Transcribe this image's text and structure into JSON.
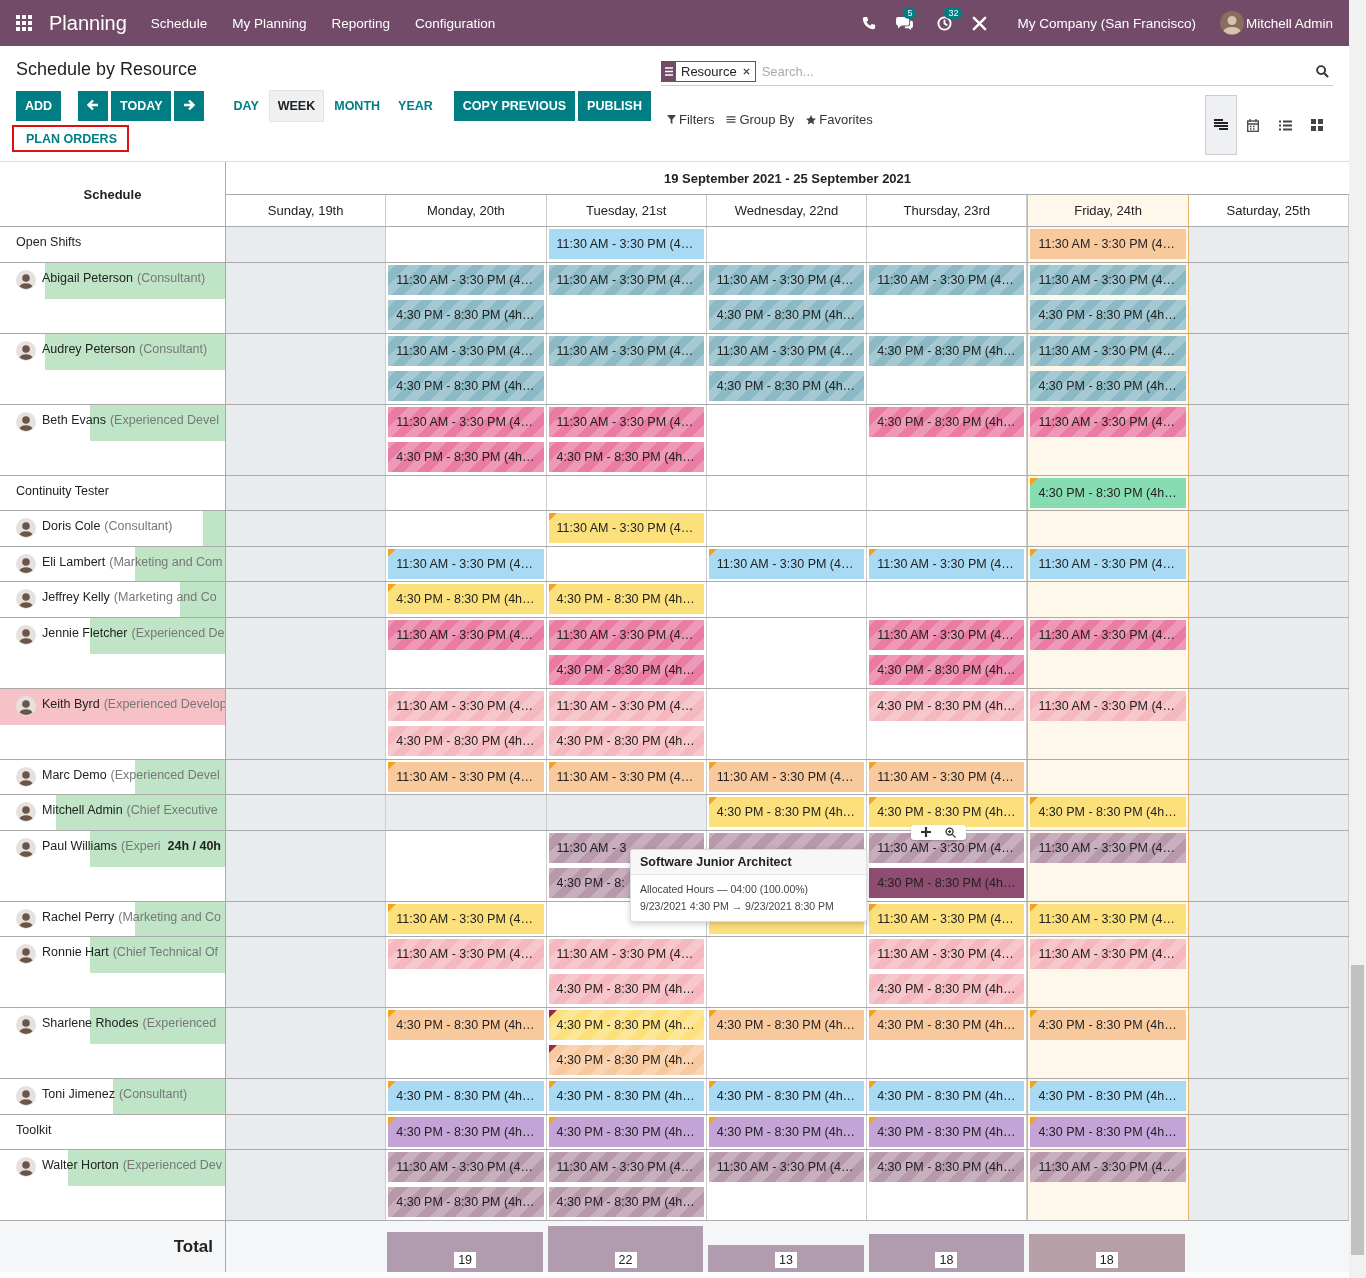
{
  "navbar": {
    "app": "Planning",
    "menu": [
      "Schedule",
      "My Planning",
      "Reporting",
      "Configuration"
    ],
    "messages_badge": "5",
    "activities_badge": "32",
    "company": "My Company (San Francisco)",
    "user": "Mitchell Admin"
  },
  "control_panel": {
    "title": "Schedule by Resource",
    "add": "ADD",
    "today": "TODAY",
    "scales": [
      {
        "label": "DAY",
        "selected": false
      },
      {
        "label": "WEEK",
        "selected": true
      },
      {
        "label": "MONTH",
        "selected": false
      },
      {
        "label": "YEAR",
        "selected": false
      }
    ],
    "actions": [
      "COPY PREVIOUS",
      "PUBLISH"
    ],
    "plan_orders": "PLAN ORDERS",
    "search": {
      "facet": "Resource",
      "placeholder": "Search..."
    },
    "filters": [
      "Filters",
      "Group By",
      "Favorites"
    ],
    "view_modes": [
      {
        "kind": "gantt",
        "selected": true
      },
      {
        "kind": "calendar",
        "selected": false
      },
      {
        "kind": "list",
        "selected": false
      },
      {
        "kind": "kanban",
        "selected": false
      }
    ]
  },
  "gantt": {
    "corner": "Schedule",
    "range": "19 September 2021 - 25 September 2021",
    "days": [
      {
        "label": "Sunday, 19th",
        "weekend": true,
        "today": false
      },
      {
        "label": "Monday, 20th",
        "weekend": false,
        "today": false
      },
      {
        "label": "Tuesday, 21st",
        "weekend": false,
        "today": false
      },
      {
        "label": "Wednesday, 22nd",
        "weekend": false,
        "today": false
      },
      {
        "label": "Thursday, 23rd",
        "weekend": false,
        "today": false
      },
      {
        "label": "Friday, 24th",
        "weekend": false,
        "today": true
      },
      {
        "label": "Saturday, 25th",
        "weekend": true,
        "today": false
      }
    ],
    "rows": [
      {
        "name": "Open Shifts",
        "kind": "group",
        "cells": [
          {},
          {},
          {
            "pills": [
              {
                "text": "11:30 AM - 3:30 PM (4…",
                "color": "#a8daf4",
                "striped": false
              }
            ]
          },
          {},
          {},
          {
            "pills": [
              {
                "text": "11:30 AM - 3:30 PM (4…",
                "color": "#f9c99e",
                "striped": false
              }
            ]
          },
          {}
        ]
      },
      {
        "name": "Abigail Peterson",
        "role": "(Consultant)",
        "kind": "person",
        "level": 0.8,
        "overloaded": false,
        "cells": [
          {},
          {
            "pills": [
              {
                "text": "11:30 AM - 3:30 PM (4…",
                "color": "#8bbac6",
                "striped": true
              },
              {
                "text": "4:30 PM - 8:30 PM (4h…",
                "color": "#8bbac6",
                "striped": true
              }
            ]
          },
          {
            "pills": [
              {
                "text": "11:30 AM - 3:30 PM (4…",
                "color": "#8bbac6",
                "striped": true
              }
            ]
          },
          {
            "pills": [
              {
                "text": "11:30 AM - 3:30 PM (4…",
                "color": "#8bbac6",
                "striped": true
              },
              {
                "text": "4:30 PM - 8:30 PM (4h…",
                "color": "#8bbac6",
                "striped": true
              }
            ]
          },
          {
            "pills": [
              {
                "text": "11:30 AM - 3:30 PM (4…",
                "color": "#8bbac6",
                "striped": true
              }
            ]
          },
          {
            "pills": [
              {
                "text": "11:30 AM - 3:30 PM (4…",
                "color": "#8bbac6",
                "striped": true
              },
              {
                "text": "4:30 PM - 8:30 PM (4h…",
                "color": "#8bbac6",
                "striped": true
              }
            ]
          },
          {}
        ]
      },
      {
        "name": "Audrey Peterson",
        "role": "(Consultant)",
        "kind": "person",
        "level": 0.8,
        "overloaded": false,
        "cells": [
          {},
          {
            "pills": [
              {
                "text": "11:30 AM - 3:30 PM (4…",
                "color": "#8bbac6",
                "striped": true
              },
              {
                "text": "4:30 PM - 8:30 PM (4h…",
                "color": "#8bbac6",
                "striped": true
              }
            ]
          },
          {
            "pills": [
              {
                "text": "11:30 AM - 3:30 PM (4…",
                "color": "#8bbac6",
                "striped": true
              }
            ]
          },
          {
            "pills": [
              {
                "text": "11:30 AM - 3:30 PM (4…",
                "color": "#8bbac6",
                "striped": true
              },
              {
                "text": "4:30 PM - 8:30 PM (4h…",
                "color": "#8bbac6",
                "striped": true
              }
            ]
          },
          {
            "pills": [
              {
                "text": "4:30 PM - 8:30 PM (4h…",
                "color": "#8bbac6",
                "striped": true
              }
            ]
          },
          {
            "pills": [
              {
                "text": "11:30 AM - 3:30 PM (4…",
                "color": "#8bbac6",
                "striped": true
              },
              {
                "text": "4:30 PM - 8:30 PM (4h…",
                "color": "#8bbac6",
                "striped": true
              }
            ]
          },
          {}
        ]
      },
      {
        "name": "Beth Evans",
        "role": "(Experienced Devel",
        "kind": "person",
        "level": 0.6,
        "overloaded": false,
        "cells": [
          {},
          {
            "pills": [
              {
                "text": "11:30 AM - 3:30 PM (4…",
                "color": "#ea7ba3",
                "striped": true
              },
              {
                "text": "4:30 PM - 8:30 PM (4h…",
                "color": "#ea7ba3",
                "striped": true
              }
            ]
          },
          {
            "pills": [
              {
                "text": "11:30 AM - 3:30 PM (4…",
                "color": "#ea7ba3",
                "striped": true
              },
              {
                "text": "4:30 PM - 8:30 PM (4h…",
                "color": "#ea7ba3",
                "striped": true
              }
            ]
          },
          {},
          {
            "pills": [
              {
                "text": "4:30 PM - 8:30 PM (4h…",
                "color": "#ea7ba3",
                "striped": true
              }
            ]
          },
          {
            "pills": [
              {
                "text": "11:30 AM - 3:30 PM (4…",
                "color": "#ea7ba3",
                "striped": true
              }
            ]
          },
          {}
        ]
      },
      {
        "name": "Continuity Tester",
        "kind": "group",
        "cells": [
          {},
          {},
          {},
          {},
          {},
          {
            "pills": [
              {
                "text": "4:30 PM - 8:30 PM (4h…",
                "color": "#86ddb1",
                "striped": false,
                "corner": {
                  "color": "#f5a11c"
                }
              }
            ]
          },
          {}
        ]
      },
      {
        "name": "Doris Cole",
        "role": "(Consultant)",
        "kind": "person",
        "level": 0.1,
        "overloaded": false,
        "cells": [
          {},
          {},
          {
            "pills": [
              {
                "text": "11:30 AM - 3:30 PM (4…",
                "color": "#fbe07c",
                "striped": false,
                "corner": {
                  "color": "#f5a11c"
                }
              }
            ]
          },
          {},
          {},
          {},
          {}
        ]
      },
      {
        "name": "Eli Lambert",
        "role": "(Marketing and Com",
        "kind": "person",
        "level": 0.4,
        "overloaded": false,
        "cells": [
          {},
          {
            "pills": [
              {
                "text": "11:30 AM - 3:30 PM (4…",
                "color": "#a8daf4",
                "striped": false,
                "corner": {
                  "color": "#f5a11c"
                }
              }
            ]
          },
          {},
          {
            "pills": [
              {
                "text": "11:30 AM - 3:30 PM (4…",
                "color": "#a8daf4",
                "striped": false,
                "corner": {
                  "color": "#f5a11c"
                }
              }
            ]
          },
          {
            "pills": [
              {
                "text": "11:30 AM - 3:30 PM (4…",
                "color": "#a8daf4",
                "striped": false,
                "corner": {
                  "color": "#f5a11c"
                }
              }
            ]
          },
          {
            "pills": [
              {
                "text": "11:30 AM - 3:30 PM (4…",
                "color": "#a8daf4",
                "striped": false,
                "corner": {
                  "color": "#f5a11c"
                }
              }
            ]
          },
          {}
        ]
      },
      {
        "name": "Jeffrey Kelly",
        "role": "(Marketing and Co",
        "kind": "person",
        "level": 0.2,
        "overloaded": false,
        "cells": [
          {},
          {
            "pills": [
              {
                "text": "4:30 PM - 8:30 PM (4h…",
                "color": "#fbe07c",
                "striped": false,
                "corner": {
                  "color": "#f5a11c"
                }
              }
            ]
          },
          {
            "pills": [
              {
                "text": "4:30 PM - 8:30 PM (4h…",
                "color": "#fbe07c",
                "striped": false,
                "corner": {
                  "color": "#f5a11c"
                }
              }
            ]
          },
          {},
          {},
          {},
          {}
        ]
      },
      {
        "name": "Jennie Fletcher",
        "role": "(Experienced De",
        "kind": "person",
        "level": 0.6,
        "overloaded": false,
        "cells": [
          {},
          {
            "pills": [
              {
                "text": "11:30 AM - 3:30 PM (4…",
                "color": "#ea7ba3",
                "striped": true
              }
            ]
          },
          {
            "pills": [
              {
                "text": "11:30 AM - 3:30 PM (4…",
                "color": "#ea7ba3",
                "striped": true
              },
              {
                "text": "4:30 PM - 8:30 PM (4h…",
                "color": "#ea7ba3",
                "striped": true
              }
            ]
          },
          {},
          {
            "pills": [
              {
                "text": "11:30 AM - 3:30 PM (4…",
                "color": "#ea7ba3",
                "striped": true
              },
              {
                "text": "4:30 PM - 8:30 PM (4h…",
                "color": "#ea7ba3",
                "striped": true
              }
            ]
          },
          {
            "pills": [
              {
                "text": "11:30 AM - 3:30 PM (4…",
                "color": "#ea7ba3",
                "striped": true
              }
            ]
          },
          {}
        ]
      },
      {
        "name": "Keith Byrd",
        "role": "(Experienced Develop",
        "kind": "person",
        "level": 1,
        "overloaded": true,
        "cells": [
          {},
          {
            "pills": [
              {
                "text": "11:30 AM - 3:30 PM (4…",
                "color": "#f4b8be",
                "striped": true
              },
              {
                "text": "4:30 PM - 8:30 PM (4h…",
                "color": "#f4b8be",
                "striped": true
              }
            ]
          },
          {
            "pills": [
              {
                "text": "11:30 AM - 3:30 PM (4…",
                "color": "#f4b8be",
                "striped": true
              },
              {
                "text": "4:30 PM - 8:30 PM (4h…",
                "color": "#f4b8be",
                "striped": true
              }
            ]
          },
          {},
          {
            "pills": [
              {
                "text": "4:30 PM - 8:30 PM (4h…",
                "color": "#f4b8be",
                "striped": true
              }
            ]
          },
          {
            "pills": [
              {
                "text": "11:30 AM - 3:30 PM (4…",
                "color": "#f4b8be",
                "striped": true
              }
            ]
          },
          {}
        ]
      },
      {
        "name": "Marc Demo",
        "role": "(Experienced Devel",
        "kind": "person",
        "level": 0.4,
        "overloaded": false,
        "cells": [
          {},
          {
            "pills": [
              {
                "text": "11:30 AM - 3:30 PM (4…",
                "color": "#f9c99e",
                "striped": false,
                "corner": {
                  "color": "#f5a11c"
                }
              }
            ]
          },
          {
            "pills": [
              {
                "text": "11:30 AM - 3:30 PM (4…",
                "color": "#f9c99e",
                "striped": false,
                "corner": {
                  "color": "#f5a11c"
                }
              }
            ]
          },
          {
            "pills": [
              {
                "text": "11:30 AM - 3:30 PM (4…",
                "color": "#f9c99e",
                "striped": false,
                "corner": {
                  "color": "#f5a11c"
                }
              }
            ]
          },
          {
            "pills": [
              {
                "text": "11:30 AM - 3:30 PM (4…",
                "color": "#f9c99e",
                "striped": false,
                "corner": {
                  "color": "#f5a11c"
                }
              }
            ]
          },
          {},
          {}
        ]
      },
      {
        "name": "Mitchell Admin",
        "role": "(Chief Executive",
        "kind": "person",
        "level": 0.75,
        "overloaded": false,
        "cells": [
          {},
          {
            "unavailable": true
          },
          {
            "unavailable": true
          },
          {
            "pills": [
              {
                "text": "4:30 PM - 8:30 PM (4h…",
                "color": "#fbe07c",
                "striped": false,
                "corner": {
                  "color": "#f5a11c"
                }
              }
            ]
          },
          {
            "pills": [
              {
                "text": "4:30 PM - 8:30 PM (4h…",
                "color": "#fbe07c",
                "striped": false,
                "corner": {
                  "color": "#f5a11c"
                }
              }
            ]
          },
          {
            "pills": [
              {
                "text": "4:30 PM - 8:30 PM (4h…",
                "color": "#fbe07c",
                "striped": false,
                "corner": {
                  "color": "#f5a11c"
                }
              }
            ]
          },
          {}
        ]
      },
      {
        "name": "Paul Williams",
        "role": "(Experi",
        "hours": "24h / 40h",
        "kind": "person",
        "level": 0.6,
        "overloaded": false,
        "cells": [
          {},
          {},
          {
            "pills": [
              {
                "text": "11:30 AM - 3",
                "color": "#b899ab",
                "striped": true
              },
              {
                "text": "4:30 PM - 8:",
                "color": "#b899ab",
                "striped": true
              }
            ]
          },
          {
            "pills": [
              {
                "color": "#b899ab",
                "striped": true
              }
            ]
          },
          {
            "pills": [
              {
                "text": "11:30 AM - 3:30 PM (4…",
                "color": "#b899ab",
                "striped": true,
                "hovered": true
              },
              {
                "text": "4:30 PM - 8:30 PM (4h…",
                "color": "#8f4d72",
                "striped": false
              }
            ]
          },
          {
            "pills": [
              {
                "text": "11:30 AM - 3:30 PM (4…",
                "color": "#b899ab",
                "striped": true
              }
            ]
          },
          {}
        ]
      },
      {
        "name": "Rachel Perry",
        "role": "(Marketing and Co",
        "kind": "person",
        "level": 0.4,
        "overloaded": false,
        "cells": [
          {},
          {
            "pills": [
              {
                "text": "11:30 AM - 3:30 PM (4…",
                "color": "#fbe07c",
                "striped": false,
                "corner": {
                  "color": "#f5a11c"
                }
              }
            ]
          },
          {},
          {
            "pills": [
              {
                "color": "#fbe07c",
                "striped": false
              }
            ]
          },
          {
            "pills": [
              {
                "text": "11:30 AM - 3:30 PM (4…",
                "color": "#fbe07c",
                "striped": false,
                "corner": {
                  "color": "#f5a11c"
                }
              }
            ]
          },
          {
            "pills": [
              {
                "text": "11:30 AM - 3:30 PM (4…",
                "color": "#fbe07c",
                "striped": false,
                "corner": {
                  "color": "#f5a11c"
                }
              }
            ]
          },
          {}
        ]
      },
      {
        "name": "Ronnie Hart",
        "role": "(Chief Technical Of",
        "kind": "person",
        "level": 0.6,
        "overloaded": false,
        "cells": [
          {},
          {
            "pills": [
              {
                "text": "11:30 AM - 3:30 PM (4…",
                "color": "#f4b8be",
                "striped": true
              }
            ]
          },
          {
            "pills": [
              {
                "text": "11:30 AM - 3:30 PM (4…",
                "color": "#f4b8be",
                "striped": true
              },
              {
                "text": "4:30 PM - 8:30 PM (4h…",
                "color": "#f4b8be",
                "striped": true
              }
            ]
          },
          {},
          {
            "pills": [
              {
                "text": "11:30 AM - 3:30 PM (4…",
                "color": "#f4b8be",
                "striped": true
              },
              {
                "text": "4:30 PM - 8:30 PM (4h…",
                "color": "#f4b8be",
                "striped": true
              }
            ]
          },
          {
            "pills": [
              {
                "text": "11:30 AM - 3:30 PM (4…",
                "color": "#f4b8be",
                "striped": true
              }
            ]
          },
          {}
        ]
      },
      {
        "name": "Sharlene Rhodes",
        "role": "(Experienced",
        "kind": "person",
        "level": 0.6,
        "overloaded": false,
        "cells": [
          {},
          {
            "pills": [
              {
                "text": "4:30 PM - 8:30 PM (4h…",
                "color": "#f9c99e",
                "striped": false,
                "corner": {
                  "color": "#f5a11c"
                }
              }
            ]
          },
          {
            "pills": [
              {
                "text": "4:30 PM - 8:30 PM (4h…",
                "color": "#fbe07c",
                "striped": true,
                "corner": {
                  "color": "#a3234b"
                }
              },
              {
                "text": "4:30 PM - 8:30 PM (4h…",
                "color": "#f9c99e",
                "striped": true,
                "corner": {
                  "color": "#a3234b"
                }
              }
            ]
          },
          {
            "pills": [
              {
                "text": "4:30 PM - 8:30 PM (4h…",
                "color": "#f9c99e",
                "striped": false,
                "corner": {
                  "color": "#f5a11c"
                }
              }
            ]
          },
          {
            "pills": [
              {
                "text": "4:30 PM - 8:30 PM (4h…",
                "color": "#f9c99e",
                "striped": false,
                "corner": {
                  "color": "#f5a11c"
                }
              }
            ]
          },
          {
            "pills": [
              {
                "text": "4:30 PM - 8:30 PM (4h…",
                "color": "#f9c99e",
                "striped": false,
                "corner": {
                  "color": "#f5a11c"
                }
              }
            ]
          },
          {}
        ]
      },
      {
        "name": "Toni Jimenez",
        "role": "(Consultant)",
        "kind": "person",
        "level": 0.5,
        "overloaded": false,
        "cells": [
          {},
          {
            "pills": [
              {
                "text": "4:30 PM - 8:30 PM (4h…",
                "color": "#a8daf4",
                "striped": false,
                "corner": {
                  "color": "#f5a11c"
                }
              }
            ]
          },
          {
            "pills": [
              {
                "text": "4:30 PM - 8:30 PM (4h…",
                "color": "#a8daf4",
                "striped": false,
                "corner": {
                  "color": "#f5a11c"
                }
              }
            ]
          },
          {
            "pills": [
              {
                "text": "4:30 PM - 8:30 PM (4h…",
                "color": "#a8daf4",
                "striped": false,
                "corner": {
                  "color": "#f5a11c"
                }
              }
            ]
          },
          {
            "pills": [
              {
                "text": "4:30 PM - 8:30 PM (4h…",
                "color": "#a8daf4",
                "striped": false,
                "corner": {
                  "color": "#f5a11c"
                }
              }
            ]
          },
          {
            "pills": [
              {
                "text": "4:30 PM - 8:30 PM (4h…",
                "color": "#a8daf4",
                "striped": false,
                "corner": {
                  "color": "#f5a11c"
                }
              }
            ]
          },
          {}
        ]
      },
      {
        "name": "Toolkit",
        "kind": "group",
        "cells": [
          {},
          {
            "pills": [
              {
                "text": "4:30 PM - 8:30 PM (4h…",
                "color": "#c4a3d7",
                "striped": false,
                "corner": {
                  "color": "#f5a11c"
                }
              }
            ]
          },
          {
            "pills": [
              {
                "text": "4:30 PM - 8:30 PM (4h…",
                "color": "#c4a3d7",
                "striped": false,
                "corner": {
                  "color": "#f5a11c"
                }
              }
            ]
          },
          {
            "pills": [
              {
                "text": "4:30 PM - 8:30 PM (4h…",
                "color": "#c4a3d7",
                "striped": false,
                "corner": {
                  "color": "#f5a11c"
                }
              }
            ]
          },
          {
            "pills": [
              {
                "text": "4:30 PM - 8:30 PM (4h…",
                "color": "#c4a3d7",
                "striped": false,
                "corner": {
                  "color": "#f5a11c"
                }
              }
            ]
          },
          {
            "pills": [
              {
                "text": "4:30 PM - 8:30 PM (4h…",
                "color": "#c4a3d7",
                "striped": false,
                "corner": {
                  "color": "#f5a11c"
                }
              }
            ]
          },
          {}
        ]
      },
      {
        "name": "Walter Horton",
        "role": "(Experienced Dev",
        "kind": "person",
        "level": 0.7,
        "overloaded": false,
        "cells": [
          {},
          {
            "pills": [
              {
                "text": "11:30 AM - 3:30 PM (4…",
                "color": "#b899ab",
                "striped": true
              },
              {
                "text": "4:30 PM - 8:30 PM (4h…",
                "color": "#b899ab",
                "striped": true
              }
            ]
          },
          {
            "pills": [
              {
                "text": "11:30 AM - 3:30 PM (4…",
                "color": "#b899ab",
                "striped": true
              },
              {
                "text": "4:30 PM - 8:30 PM (4h…",
                "color": "#b899ab",
                "striped": true
              }
            ]
          },
          {
            "pills": [
              {
                "text": "11:30 AM - 3:30 PM (4…",
                "color": "#b899ab",
                "striped": true
              }
            ]
          },
          {
            "pills": [
              {
                "text": "4:30 PM - 8:30 PM (4h…",
                "color": "#b899ab",
                "striped": true
              }
            ]
          },
          {
            "pills": [
              {
                "text": "11:30 AM - 3:30 PM (4…",
                "color": "#b899ab",
                "striped": true
              }
            ]
          },
          {}
        ]
      }
    ],
    "total_label": "Total",
    "totals": [
      {
        "kind": "empty"
      },
      {
        "kind": "bar",
        "value": "19"
      },
      {
        "kind": "bar",
        "value": "22"
      },
      {
        "kind": "bar",
        "value": "13"
      },
      {
        "kind": "bar",
        "value": "18"
      },
      {
        "kind": "bar",
        "value": "18"
      },
      {
        "kind": "empty"
      }
    ]
  },
  "tooltip": {
    "title": "Software Junior Architect",
    "lines": [
      "Allocated Hours — 04:00 (100.00%)",
      "9/23/2021 4:30 PM → 9/23/2021 8:30 PM"
    ]
  }
}
